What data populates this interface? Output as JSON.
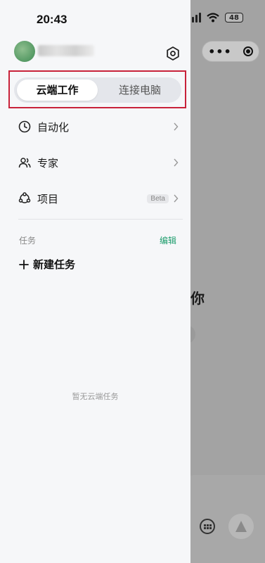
{
  "status_bar": {
    "time": "20:43",
    "battery": "48"
  },
  "drawer": {
    "toggle": {
      "active_tab": "云端工作",
      "inactive_tab": "连接电脑"
    },
    "menu": [
      {
        "label": "自动化",
        "icon": "clock-icon"
      },
      {
        "label": "专家",
        "icon": "users-icon"
      },
      {
        "label": "项目",
        "icon": "project-icon",
        "badge": "Beta"
      }
    ],
    "tasks": {
      "section_label": "任务",
      "edit_label": "编辑",
      "new_task_label": "新建任务",
      "empty_text": "暂无云端任务"
    }
  },
  "background": {
    "heading_fragment": "你"
  },
  "colors": {
    "accent": "#1e9d6d",
    "highlight_border": "#c8223a",
    "drawer_bg": "#f6f7f9"
  }
}
